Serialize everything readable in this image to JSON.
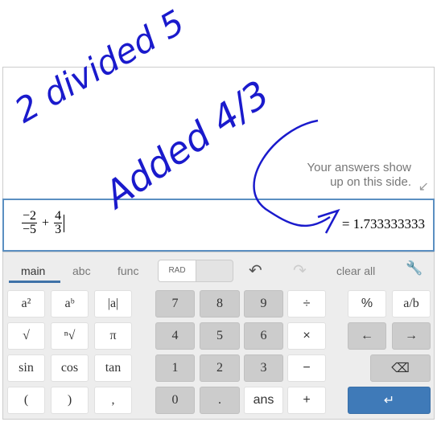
{
  "hint": {
    "line1": "Your answers show",
    "line2": "up on this side."
  },
  "expression": {
    "term1": {
      "numerator": "−2",
      "denominator": "−5"
    },
    "operator": "+",
    "term2": {
      "numerator": "4",
      "denominator": "3"
    }
  },
  "result": "= 1.733333333",
  "tabs": [
    {
      "label": "main",
      "active": true
    },
    {
      "label": "abc"
    },
    {
      "label": "func"
    }
  ],
  "angle_mode": "RAD",
  "clear_all": "clear all",
  "keys": {
    "functions": [
      "a²",
      "aᵇ",
      "|a|",
      "√",
      "ⁿ√",
      "π",
      "sin",
      "cos",
      "tan",
      "(",
      ")",
      ","
    ],
    "digits": [
      "7",
      "8",
      "9",
      "4",
      "5",
      "6",
      "1",
      "2",
      "3",
      "0",
      ".",
      "ans"
    ],
    "operators": [
      "÷",
      "×",
      "−",
      "+"
    ],
    "extra": [
      "%",
      "a/b",
      "←",
      "→",
      "⌫",
      "↵"
    ]
  },
  "annotations": {
    "line1": "2 divided 5",
    "line2": "Added 4/3"
  },
  "colors": {
    "accent": "#3f7ab8",
    "ink": "#1a1acc"
  }
}
